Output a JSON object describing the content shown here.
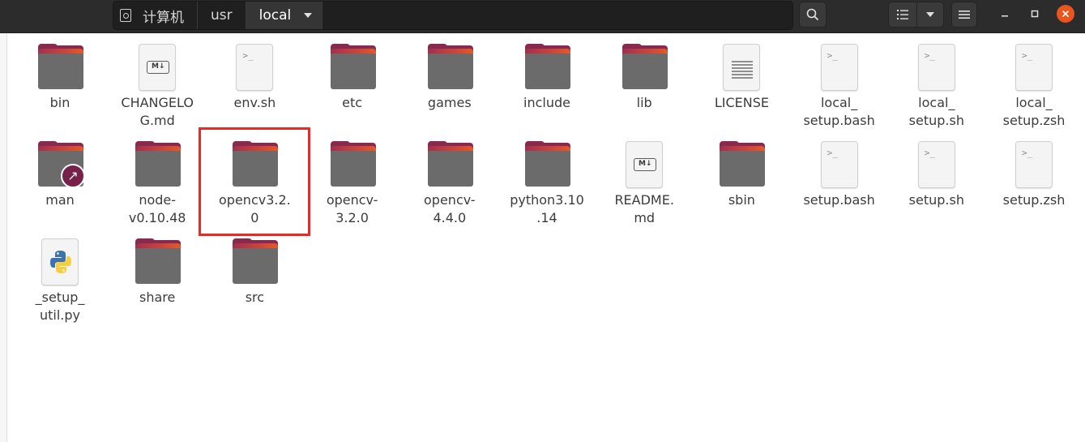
{
  "header": {
    "breadcrumbs": [
      "计算机",
      "usr",
      "local"
    ]
  },
  "files": [
    {
      "label": "bin",
      "icon": "folder-icon"
    },
    {
      "label": "CHANGELOG.md",
      "display": "CHANGELO\nG.md",
      "icon": "markdown-file-icon"
    },
    {
      "label": "env.sh",
      "icon": "shell-script-icon"
    },
    {
      "label": "etc",
      "icon": "folder-icon"
    },
    {
      "label": "games",
      "icon": "folder-icon"
    },
    {
      "label": "include",
      "icon": "folder-icon"
    },
    {
      "label": "lib",
      "icon": "folder-icon"
    },
    {
      "label": "LICENSE",
      "icon": "text-file-icon"
    },
    {
      "label": "local_setup.bash",
      "display": "local_\nsetup.bash",
      "icon": "shell-script-icon"
    },
    {
      "label": "local_setup.sh",
      "display": "local_\nsetup.sh",
      "icon": "shell-script-icon"
    },
    {
      "label": "local_setup.zsh",
      "display": "local_\nsetup.zsh",
      "icon": "shell-script-icon"
    },
    {
      "label": "man",
      "icon": "folder-link-icon"
    },
    {
      "label": "node-v0.10.48",
      "display": "node-\nv0.10.48",
      "icon": "folder-icon"
    },
    {
      "label": "opencv3.2.0",
      "display": "opencv3.2.\n0",
      "icon": "folder-icon",
      "selected": true
    },
    {
      "label": "opencv-3.2.0",
      "display": "opencv-\n3.2.0",
      "icon": "folder-icon"
    },
    {
      "label": "opencv-4.4.0",
      "display": "opencv-\n4.4.0",
      "icon": "folder-icon"
    },
    {
      "label": "python3.10.14",
      "display": "python3.10\n.14",
      "icon": "folder-icon"
    },
    {
      "label": "README.md",
      "display": "README.\nmd",
      "icon": "markdown-file-icon"
    },
    {
      "label": "sbin",
      "icon": "folder-icon"
    },
    {
      "label": "setup.bash",
      "icon": "shell-script-icon"
    },
    {
      "label": "setup.sh",
      "icon": "shell-script-icon"
    },
    {
      "label": "setup.zsh",
      "icon": "shell-script-icon"
    },
    {
      "label": "_setup_util.py",
      "display": "_setup_\nutil.py",
      "icon": "python-file-icon"
    },
    {
      "label": "share",
      "icon": "folder-icon"
    },
    {
      "label": "src",
      "icon": "folder-icon"
    }
  ],
  "colors": {
    "header_bg": "#2c2c2c",
    "folder_front": "#6b6b6b",
    "folder_back": "#872a4e",
    "folder_accent": "#e35a2a",
    "selection_outline": "#e82a25",
    "close_button": "#e9541f"
  }
}
